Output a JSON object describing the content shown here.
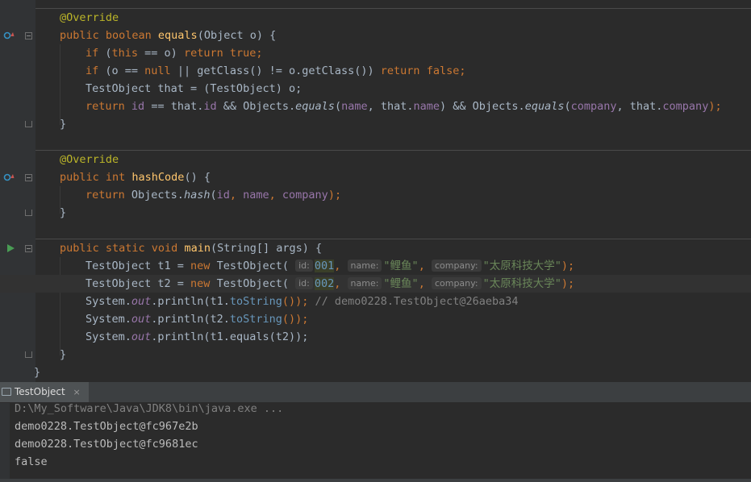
{
  "editor": {
    "l_override1": "@Override",
    "l_equals_sig": {
      "k1": "public boolean ",
      "name": "equals",
      "rest": "(Object o) {"
    },
    "l_if1": {
      "k1": "if",
      "a": " (",
      "k2": "this",
      "b": " == o) ",
      "k3": "return",
      "c": " ",
      "k4": "true",
      "d": ";"
    },
    "l_if2": {
      "k1": "if",
      "a": " (o == ",
      "k2": "null",
      "b": " || getClass() != o.getClass()) ",
      "k3": "return",
      "c": " ",
      "k4": "false",
      "d": ";"
    },
    "l_cast": "TestObject that = (TestObject) o;",
    "l_return1": {
      "k1": "return",
      "s1": " ",
      "f1": "id",
      "s2": " == that.",
      "f2": "id",
      "s3": " && Objects.",
      "m1": "equals",
      "s4": "(",
      "f3": "name",
      "s5": ", that.",
      "f4": "name",
      "s6": ") && Objects.",
      "m2": "equals",
      "s7": "(",
      "f5": "company",
      "s8": ", that.",
      "f6": "company",
      "s9": ");"
    },
    "l_close1": "}",
    "l_override2": "@Override",
    "l_hash_sig": {
      "k1": "public int ",
      "name": "hashCode",
      "rest": "() {"
    },
    "l_hash_ret": {
      "k1": "return",
      "s1": " Objects.",
      "m1": "hash",
      "s2": "(",
      "f1": "id",
      "s3": ", ",
      "f2": "name",
      "s4": ", ",
      "f3": "company",
      "s5": ");"
    },
    "l_close2": "}",
    "l_main_sig": {
      "k1": "public static void ",
      "name": "main",
      "rest": "(String[] args) {"
    },
    "l_t1": {
      "a": "TestObject t1 = ",
      "k1": "new",
      "b": " TestObject( ",
      "h1": "id:",
      "n1": "001",
      "c": ", ",
      "h2": "name:",
      "s1": "\"鲤鱼\"",
      "d": ", ",
      "h3": "company:",
      "s2": "\"太原科技大学\"",
      "e": ");"
    },
    "l_t2": {
      "a": "TestObject t2 = ",
      "k1": "new",
      "b": " TestObject( ",
      "h1": "id:",
      "n1": "002",
      "c": ", ",
      "h2": "name:",
      "s1": "\"鲤鱼\"",
      "d": ", ",
      "h3": "company:",
      "s2": "\"太原科技大学\"",
      "e": ");"
    },
    "l_p1": {
      "a": "System.",
      "out": "out",
      "b": ".println(t1.",
      "f": "toString",
      "c": "()); ",
      "cmt": "// demo0228.TestObject@26aeba34"
    },
    "l_p2": {
      "a": "System.",
      "out": "out",
      "b": ".println(t2.",
      "f": "toString",
      "c": "());"
    },
    "l_p3": {
      "a": "System.",
      "out": "out",
      "b": ".println(t1.equals(t2));"
    },
    "l_close3": "}",
    "l_close4": "}"
  },
  "run_panel": {
    "tab_label": "TestObject",
    "tab_close": "×",
    "console": [
      "D:\\My_Software\\Java\\JDK8\\bin\\java.exe ...",
      "demo0228.TestObject@fc967e2b",
      "demo0228.TestObject@fc9681ec",
      "false"
    ]
  },
  "colors": {
    "background": "#2b2b2b",
    "keyword": "#cc7832",
    "annotation": "#bbb529",
    "method_decl": "#ffc66d",
    "field": "#9876aa",
    "number": "#6897bb",
    "string": "#6a8759",
    "comment": "#808080",
    "text": "#a9b7c6"
  },
  "icons": {
    "override_marker": "override-method-icon",
    "run_marker": "run-gutter-icon",
    "fold_marker": "fold-icon"
  }
}
